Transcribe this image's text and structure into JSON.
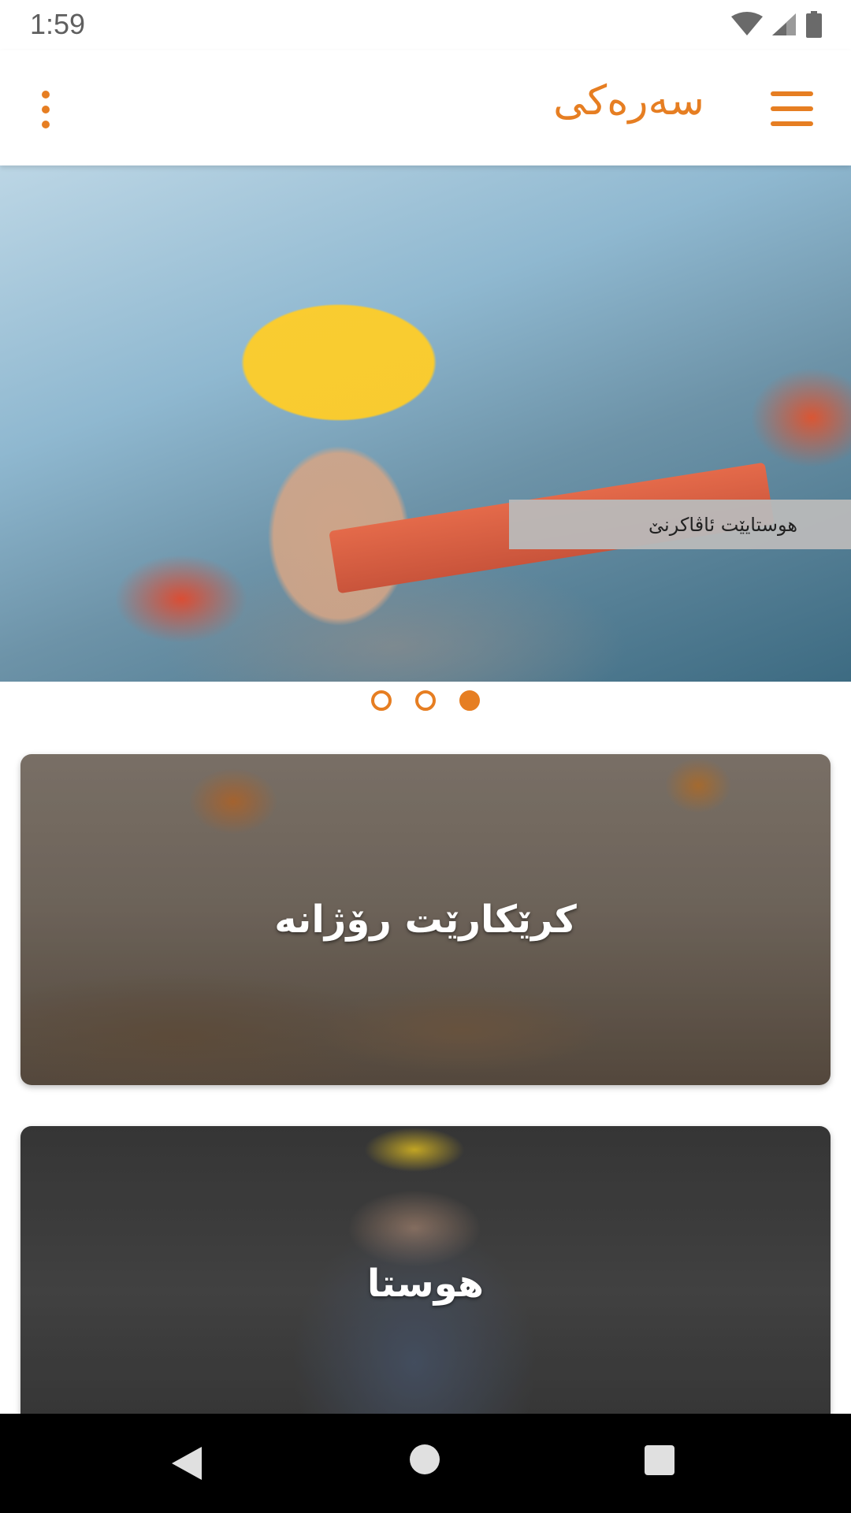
{
  "status_bar": {
    "time": "1:59",
    "icons": [
      "wifi-icon",
      "signal-icon",
      "battery-icon"
    ]
  },
  "app_bar": {
    "title": "سەرەکی",
    "overflow_icon": "more-vertical-icon",
    "menu_icon": "hamburger-menu-icon"
  },
  "slider": {
    "caption": "هوستایێت ئاڤاکرنێ",
    "page_count": 3,
    "active_page": 3
  },
  "cards": [
    {
      "label": "کرێکارێت رۆژانە"
    },
    {
      "label": "هوستا"
    }
  ],
  "nav_bar": {
    "icons": [
      "back-icon",
      "home-icon",
      "recents-icon"
    ]
  },
  "colors": {
    "accent": "#e67e22",
    "nav_bar": "#000000",
    "caption_bg": "#b9b9b9"
  }
}
